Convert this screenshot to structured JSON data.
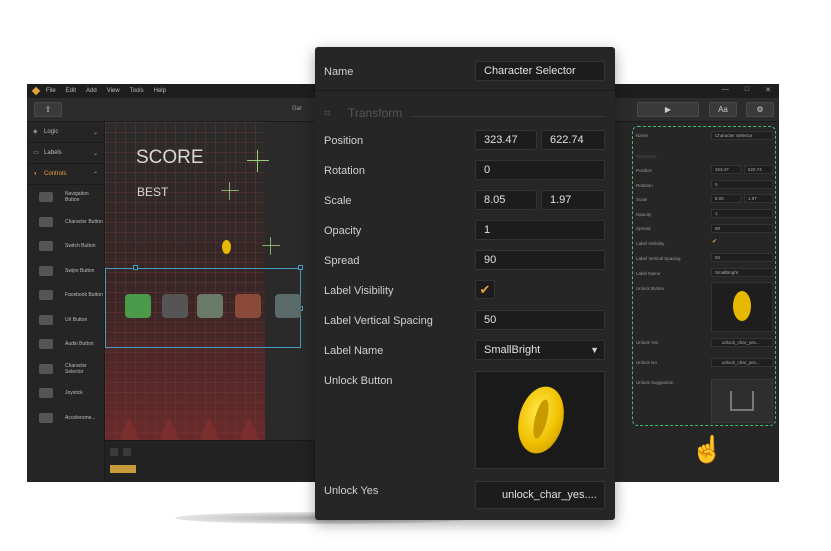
{
  "background_editor": {
    "menu": [
      "File",
      "Edit",
      "Add",
      "View",
      "Tools",
      "Help"
    ],
    "window_controls": [
      "—",
      "□",
      "✕"
    ],
    "toolbar_label": "Gar",
    "categories": [
      {
        "label": "Logic",
        "active": false
      },
      {
        "label": "Labels",
        "active": false
      },
      {
        "label": "Controls",
        "active": true
      }
    ],
    "controls": [
      "Navigation Button",
      "Character Button",
      "Switch Button",
      "Swipe Button",
      "Facebook Button",
      "Url Button",
      "Audio Button",
      "Character Selector",
      "Joystick",
      "Accelerome..."
    ],
    "game": {
      "score_label": "SCORE",
      "best_label": "BEST"
    },
    "right_panel": {
      "name_label": "Name",
      "name_value": "Character Selector",
      "transform_label": "Transform",
      "position_label": "Position",
      "pos_x": "323.47",
      "pos_y": "622.74",
      "rotation_label": "Rotation",
      "rotation": "0",
      "scale_label": "Scale",
      "scale_x": "8.05",
      "scale_y": "1.97",
      "opacity_label": "Opacity",
      "opacity": "1",
      "spread_label": "Spread",
      "spread": "90",
      "label_visibility": "Label Visibility",
      "label_vertical_spacing": "Label Vertical Spacing",
      "spacing": "50",
      "label_name": "Label Name",
      "label_name_value": "SmallBright",
      "unlock_button": "Unlock Button",
      "unlock_yes": "Unlock Yes",
      "unlock_yes_value": "unlock_char_yes...",
      "unlock_no": "Unlock No",
      "unlock_no_value": "unlock_char_yes...",
      "unlock_suggestion": "Unlock Suggestion"
    }
  },
  "inspector": {
    "name_label": "Name",
    "name_value": "Character Selector",
    "section_title": "Transform",
    "position_label": "Position",
    "position_x": "323.47",
    "position_y": "622.74",
    "rotation_label": "Rotation",
    "rotation": "0",
    "scale_label": "Scale",
    "scale_x": "8.05",
    "scale_y": "1.97",
    "opacity_label": "Opacity",
    "opacity": "1",
    "spread_label": "Spread",
    "spread": "90",
    "label_visibility_label": "Label Visibility",
    "label_visibility_checked": true,
    "label_vertical_spacing_label": "Label Vertical Spacing",
    "label_vertical_spacing": "50",
    "label_name_label": "Label Name",
    "label_name_value": "SmallBright",
    "unlock_button_label": "Unlock Button",
    "unlock_yes_label": "Unlock Yes",
    "unlock_yes_value": "unlock_char_yes...."
  },
  "colors": {
    "accent": "#e6a23c",
    "selection": "#3fbf6e",
    "panel": "#262626",
    "field": "#1c1c1c"
  },
  "icons": [
    "app-logo-icon",
    "play-icon",
    "font-icon",
    "gear-icon",
    "transform-icon",
    "check-icon",
    "chevron-down-icon",
    "speaker-icon",
    "upload-icon",
    "hand-pointer-icon"
  ]
}
